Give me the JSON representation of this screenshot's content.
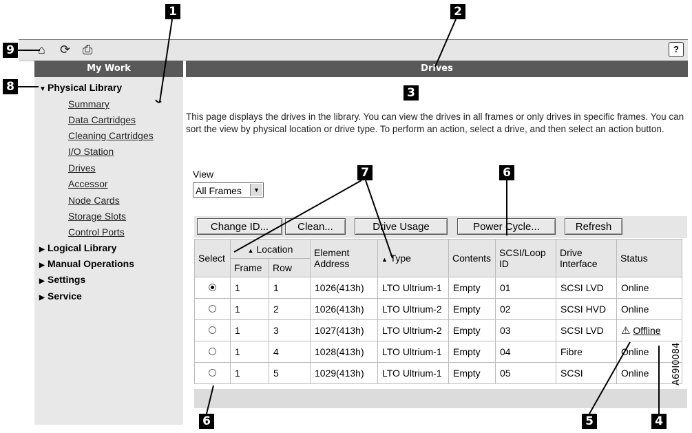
{
  "callouts": {
    "c1": "1",
    "c2": "2",
    "c3": "3",
    "c4": "4",
    "c5": "5",
    "c6a": "6",
    "c6b": "6",
    "c7": "7",
    "c8": "8",
    "c9": "9"
  },
  "toolbar": {
    "icons": [
      "home-icon",
      "refresh-icon",
      "print-icon"
    ],
    "home": "⌂",
    "refresh": "⟳",
    "print": "⎙",
    "help": "?"
  },
  "sidebar": {
    "title": "My Work",
    "sections": [
      {
        "label": "Physical Library",
        "expanded": true
      },
      {
        "label": "Logical Library",
        "expanded": false
      },
      {
        "label": "Manual Operations",
        "expanded": false
      },
      {
        "label": "Settings",
        "expanded": false
      },
      {
        "label": "Service",
        "expanded": false
      }
    ],
    "items": [
      "Summary",
      "Data Cartridges",
      "Cleaning Cartridges",
      "I/O Station",
      "Drives",
      "Accessor",
      "Node Cards",
      "Storage Slots",
      "Control Ports"
    ]
  },
  "main": {
    "title": "Drives",
    "intro": "This page displays the drives in the library. You can view the drives in all frames or only drives in specific frames. You can sort the view by physical location or drive type. To perform an action, select a drive, and then select an action button.",
    "view_label": "View",
    "view_value": "All Frames"
  },
  "actions": [
    "Change ID...",
    "Clean...",
    "Drive Usage",
    "Power Cycle...",
    "Refresh"
  ],
  "table": {
    "headers": {
      "select": "Select",
      "location": "Location",
      "frame": "Frame",
      "row": "Row",
      "element": "Element Address",
      "type": "Type",
      "contents": "Contents",
      "scsi": "SCSI/Loop ID",
      "iface": "Drive Interface",
      "status": "Status"
    },
    "rows": [
      {
        "selected": true,
        "frame": "1",
        "row": "1",
        "element": "1026(413h)",
        "type": "LTO Ultrium-1",
        "contents": "Empty",
        "scsi": "01",
        "iface": "SCSI LVD",
        "status": "Online"
      },
      {
        "selected": false,
        "frame": "1",
        "row": "2",
        "element": "1026(413h)",
        "type": "LTO Ultrium-2",
        "contents": "Empty",
        "scsi": "02",
        "iface": "SCSI HVD",
        "status": "Online"
      },
      {
        "selected": false,
        "frame": "1",
        "row": "3",
        "element": "1027(413h)",
        "type": "LTO Ultrium-2",
        "contents": "Empty",
        "scsi": "03",
        "iface": "SCSI LVD",
        "status": "Offline"
      },
      {
        "selected": false,
        "frame": "1",
        "row": "4",
        "element": "1028(413h)",
        "type": "LTO Ultrium-1",
        "contents": "Empty",
        "scsi": "04",
        "iface": "Fibre",
        "status": "Online"
      },
      {
        "selected": false,
        "frame": "1",
        "row": "5",
        "element": "1029(413h)",
        "type": "LTO Ultrium-1",
        "contents": "Empty",
        "scsi": "05",
        "iface": "SCSI",
        "status": "Online"
      }
    ]
  },
  "figure_id": "A69I0084"
}
